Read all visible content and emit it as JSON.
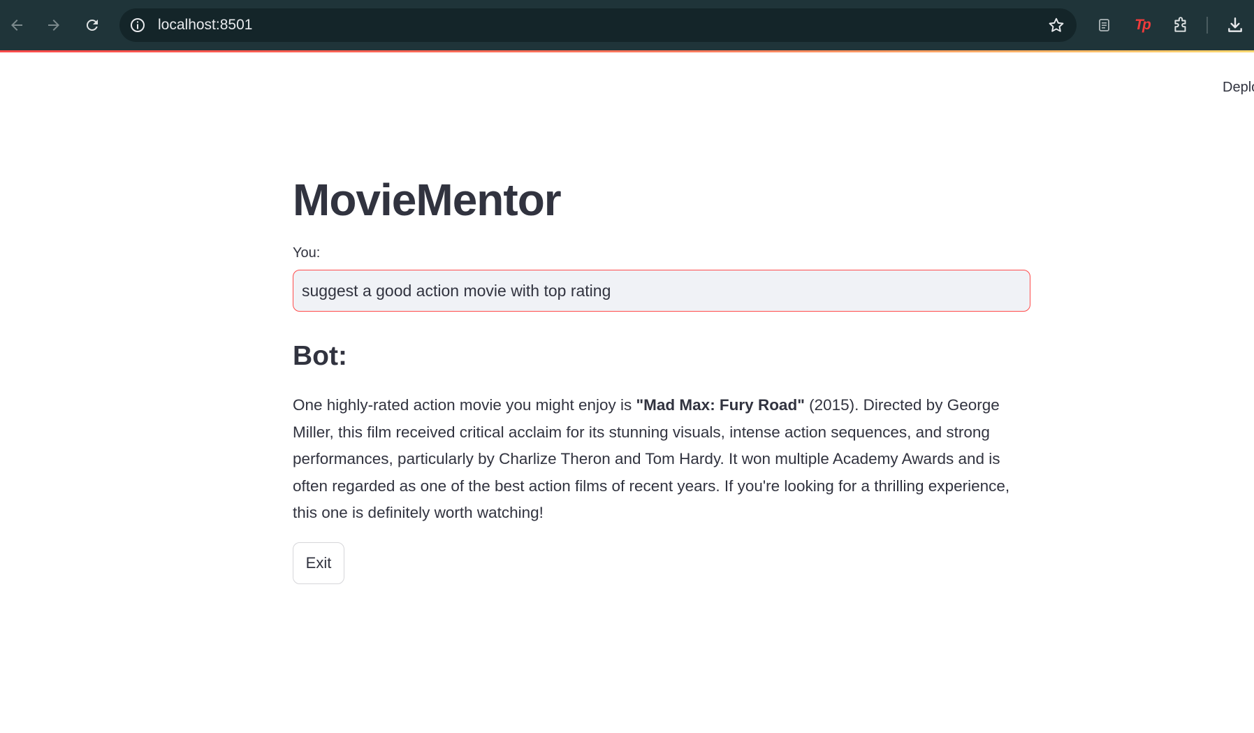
{
  "browser": {
    "url": "localhost:8501",
    "extension_label": "Tp"
  },
  "header": {
    "deploy_label": "Deploy"
  },
  "app": {
    "title": "MovieMentor",
    "input_label": "You:",
    "input_value": "suggest a good action movie with top rating",
    "bot_heading": "Bot:",
    "response_intro": "One highly-rated action movie you might enjoy is ",
    "response_bold": "\"Mad Max: Fury Road\"",
    "response_rest": " (2015). Directed by George Miller, this film received critical acclaim for its stunning visuals, intense action sequences, and strong performances, particularly by Charlize Theron and Tom Hardy. It won multiple Academy Awards and is often regarded as one of the best action films of recent years. If you're looking for a thrilling experience, this one is definitely worth watching!",
    "exit_label": "Exit"
  },
  "colors": {
    "chrome_bg": "#1f3439",
    "omnibox_bg": "#142529",
    "text": "#31333f",
    "accent": "#ff4b4b",
    "input_bg": "#f0f2f6"
  }
}
